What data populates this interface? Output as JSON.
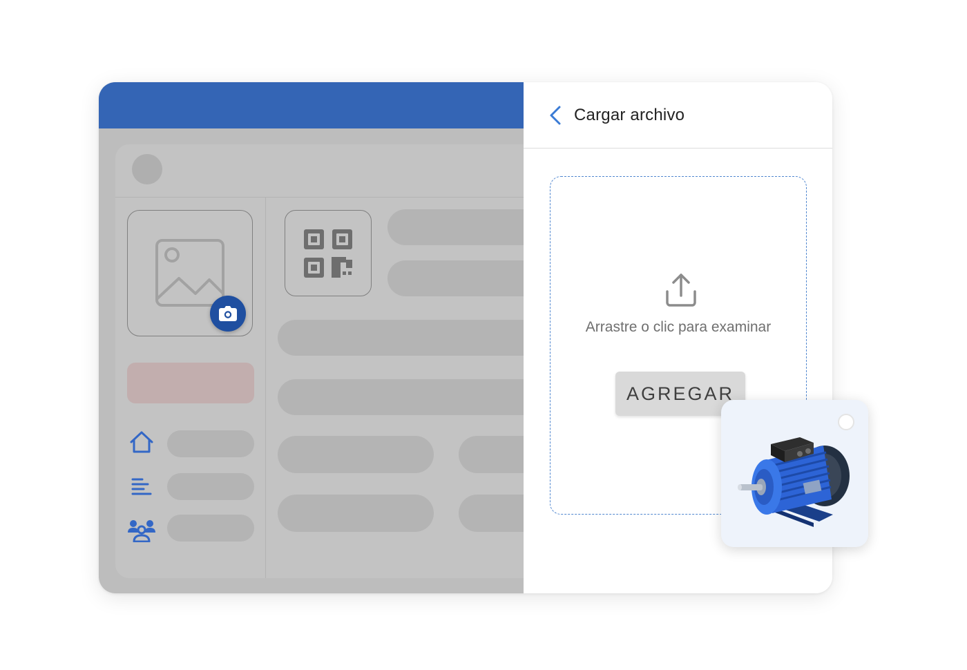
{
  "upload_panel": {
    "title": "Cargar archivo",
    "dropzone_text": "Arrastre o clic para examinar",
    "add_button_label": "AGREGAR"
  },
  "icons": {
    "back": "chevron-left-icon",
    "upload": "upload-icon",
    "camera": "camera-icon",
    "image": "image-icon",
    "qr": "qr-code-icon",
    "nav": [
      "home-icon",
      "list-icon",
      "users-icon"
    ]
  },
  "colors": {
    "brand_blue": "#3465b5",
    "accent_blue": "#4f86cf",
    "camera_blue": "#1f4fa0",
    "overlay_gray": "#bdbdbd"
  }
}
